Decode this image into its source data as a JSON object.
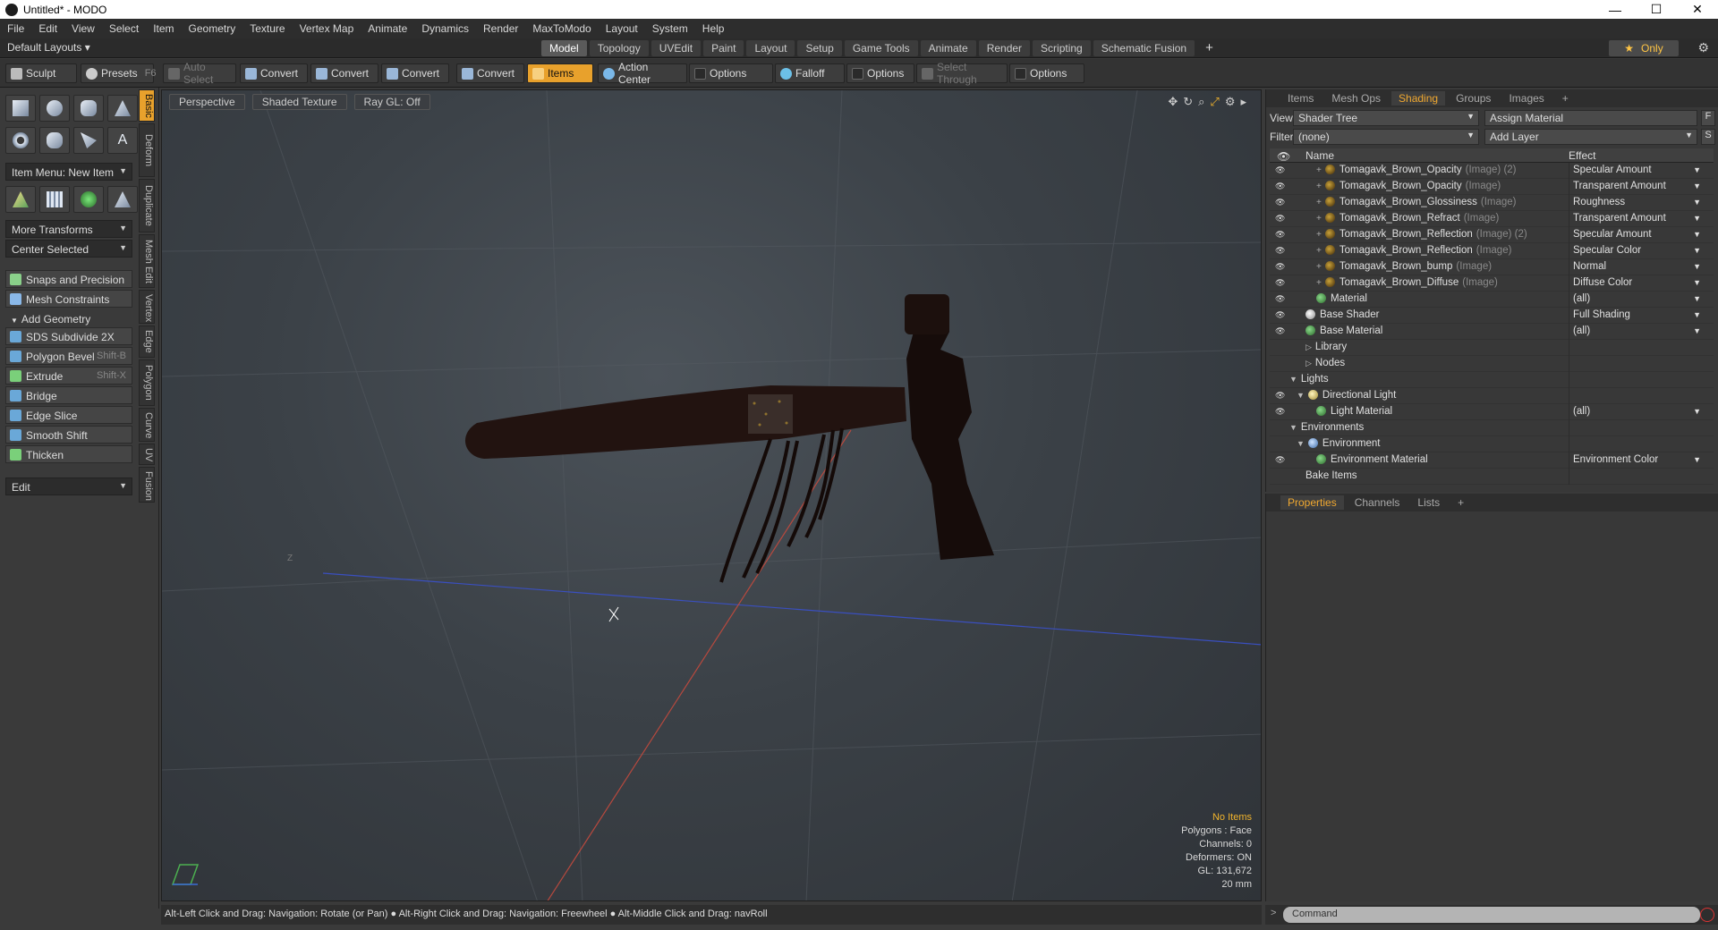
{
  "window": {
    "title": "Untitled* - MODO",
    "minimize": "—",
    "maximize": "☐",
    "close": "✕"
  },
  "menu": [
    "File",
    "Edit",
    "View",
    "Select",
    "Item",
    "Geometry",
    "Texture",
    "Vertex Map",
    "Animate",
    "Dynamics",
    "Render",
    "MaxToModo",
    "Layout",
    "System",
    "Help"
  ],
  "layouts": {
    "default_label": "Default Layouts ▾",
    "tabs": [
      "Model",
      "Topology",
      "UVEdit",
      "Paint",
      "Layout",
      "Setup",
      "Game Tools",
      "Animate",
      "Render",
      "Scripting",
      "Schematic Fusion"
    ],
    "active_tab": "Model",
    "add": "+",
    "only_label": "Only",
    "only_star": "★"
  },
  "toolbar": {
    "sculpt": "Sculpt",
    "presets": "Presets",
    "presets_key": "F6",
    "auto_select": "Auto Select",
    "convert1": "Convert",
    "convert2": "Convert",
    "convert3": "Convert",
    "convert4": "Convert",
    "items": "Items",
    "action_center": "Action Center",
    "options1": "Options",
    "falloff": "Falloff",
    "options2": "Options",
    "select_through": "Select Through",
    "options3": "Options"
  },
  "left": {
    "item_menu": "Item Menu: New Item",
    "more_transforms": "More Transforms",
    "center_selected": "Center Selected",
    "snaps": "Snaps and Precision",
    "mesh_constraints": "Mesh Constraints",
    "add_geometry": "Add Geometry",
    "tools": [
      {
        "label": "SDS Subdivide 2X",
        "key": ""
      },
      {
        "label": "Polygon Bevel",
        "key": "Shift-B"
      },
      {
        "label": "Extrude",
        "key": "Shift-X"
      },
      {
        "label": "Bridge",
        "key": ""
      },
      {
        "label": "Edge Slice",
        "key": ""
      },
      {
        "label": "Smooth Shift",
        "key": ""
      },
      {
        "label": "Thicken",
        "key": ""
      }
    ],
    "edit": "Edit",
    "vtabs": [
      "Basic",
      "Deform",
      "Duplicate",
      "Mesh Edit",
      "Vertex",
      "Edge",
      "Polygon",
      "Curve",
      "UV",
      "Fusion"
    ]
  },
  "viewport": {
    "view": "Perspective",
    "shading": "Shaded Texture",
    "raygl": "Ray GL: Off",
    "axis_label": "Z",
    "info": {
      "items": "No Items",
      "polygons": "Polygons : Face",
      "channels": "Channels: 0",
      "deformers": "Deformers: ON",
      "gl": "GL: 131,672",
      "scale": "20 mm"
    }
  },
  "status": "Alt-Left Click and Drag: Navigation: Rotate (or Pan) ● Alt-Right Click and Drag: Navigation: Freewheel ● Alt-Middle Click and Drag: navRoll",
  "right": {
    "tabs": [
      "Items",
      "Mesh Ops",
      "Shading",
      "Groups",
      "Images"
    ],
    "active_tab": "Shading",
    "add": "+",
    "view_label": "View",
    "view_value": "Shader Tree",
    "assign_material": "Assign Material",
    "f_btn": "F",
    "filter_label": "Filter",
    "filter_value": "(none)",
    "add_layer": "Add Layer",
    "s_btn": "S",
    "col_name": "Name",
    "col_effect": "Effect",
    "rows": [
      {
        "name": "Tomagavk_Brown_Opacity",
        "type": "(Image) (2)",
        "effect": "Specular Amount",
        "icon": "img",
        "indent": 52,
        "eye": true,
        "prefix": "+"
      },
      {
        "name": "Tomagavk_Brown_Opacity",
        "type": "(Image)",
        "effect": "Transparent Amount",
        "icon": "img",
        "indent": 52,
        "eye": true,
        "prefix": "+"
      },
      {
        "name": "Tomagavk_Brown_Glossiness",
        "type": "(Image)",
        "effect": "Roughness",
        "icon": "img",
        "indent": 52,
        "eye": true,
        "prefix": "+"
      },
      {
        "name": "Tomagavk_Brown_Refract",
        "type": "(Image)",
        "effect": "Transparent Amount",
        "icon": "img",
        "indent": 52,
        "eye": true,
        "prefix": "+"
      },
      {
        "name": "Tomagavk_Brown_Reflection",
        "type": "(Image) (2)",
        "effect": "Specular Amount",
        "icon": "img",
        "indent": 52,
        "eye": true,
        "prefix": "+"
      },
      {
        "name": "Tomagavk_Brown_Reflection",
        "type": "(Image)",
        "effect": "Specular Color",
        "icon": "img",
        "indent": 52,
        "eye": true,
        "prefix": "+"
      },
      {
        "name": "Tomagavk_Brown_bump",
        "type": "(Image)",
        "effect": "Normal",
        "icon": "img",
        "indent": 52,
        "eye": true,
        "prefix": "+"
      },
      {
        "name": "Tomagavk_Brown_Diffuse",
        "type": "(Image)",
        "effect": "Diffuse Color",
        "icon": "img",
        "indent": 52,
        "eye": true,
        "prefix": "+"
      },
      {
        "name": "Material",
        "type": "",
        "effect": "(all)",
        "icon": "mat",
        "indent": 52,
        "eye": true,
        "prefix": ""
      },
      {
        "name": "Base Shader",
        "type": "",
        "effect": "Full Shading",
        "icon": "wht",
        "indent": 40,
        "eye": true,
        "prefix": ""
      },
      {
        "name": "Base Material",
        "type": "",
        "effect": "(all)",
        "icon": "mat",
        "indent": 40,
        "eye": true,
        "prefix": ""
      },
      {
        "name": "Library",
        "type": "",
        "effect": "",
        "icon": "",
        "indent": 40,
        "eye": false,
        "prefix": "▷"
      },
      {
        "name": "Nodes",
        "type": "",
        "effect": "",
        "icon": "",
        "indent": 40,
        "eye": false,
        "prefix": "▷"
      },
      {
        "name": "Lights",
        "type": "",
        "effect": "",
        "icon": "",
        "indent": 22,
        "eye": false,
        "prefix": "▼"
      },
      {
        "name": "Directional Light",
        "type": "",
        "effect": "",
        "icon": "lgt",
        "indent": 30,
        "eye": true,
        "prefix": "▼"
      },
      {
        "name": "Light Material",
        "type": "",
        "effect": "(all)",
        "icon": "mat",
        "indent": 52,
        "eye": true,
        "prefix": ""
      },
      {
        "name": "Environments",
        "type": "",
        "effect": "",
        "icon": "",
        "indent": 22,
        "eye": false,
        "prefix": "▼"
      },
      {
        "name": "Environment",
        "type": "",
        "effect": "",
        "icon": "env",
        "indent": 30,
        "eye": false,
        "prefix": "▼"
      },
      {
        "name": "Environment Material",
        "type": "",
        "effect": "Environment Color",
        "icon": "mat",
        "indent": 52,
        "eye": true,
        "prefix": ""
      },
      {
        "name": "Bake Items",
        "type": "",
        "effect": "",
        "icon": "",
        "indent": 40,
        "eye": false,
        "prefix": ""
      }
    ]
  },
  "props": {
    "tabs": [
      "Properties",
      "Channels",
      "Lists"
    ],
    "active_tab": "Properties",
    "add": "+"
  },
  "command": {
    "placeholder": "Command"
  },
  "colors": {
    "accent": "#e8a12c",
    "info_highlight": "#f2b42c"
  }
}
